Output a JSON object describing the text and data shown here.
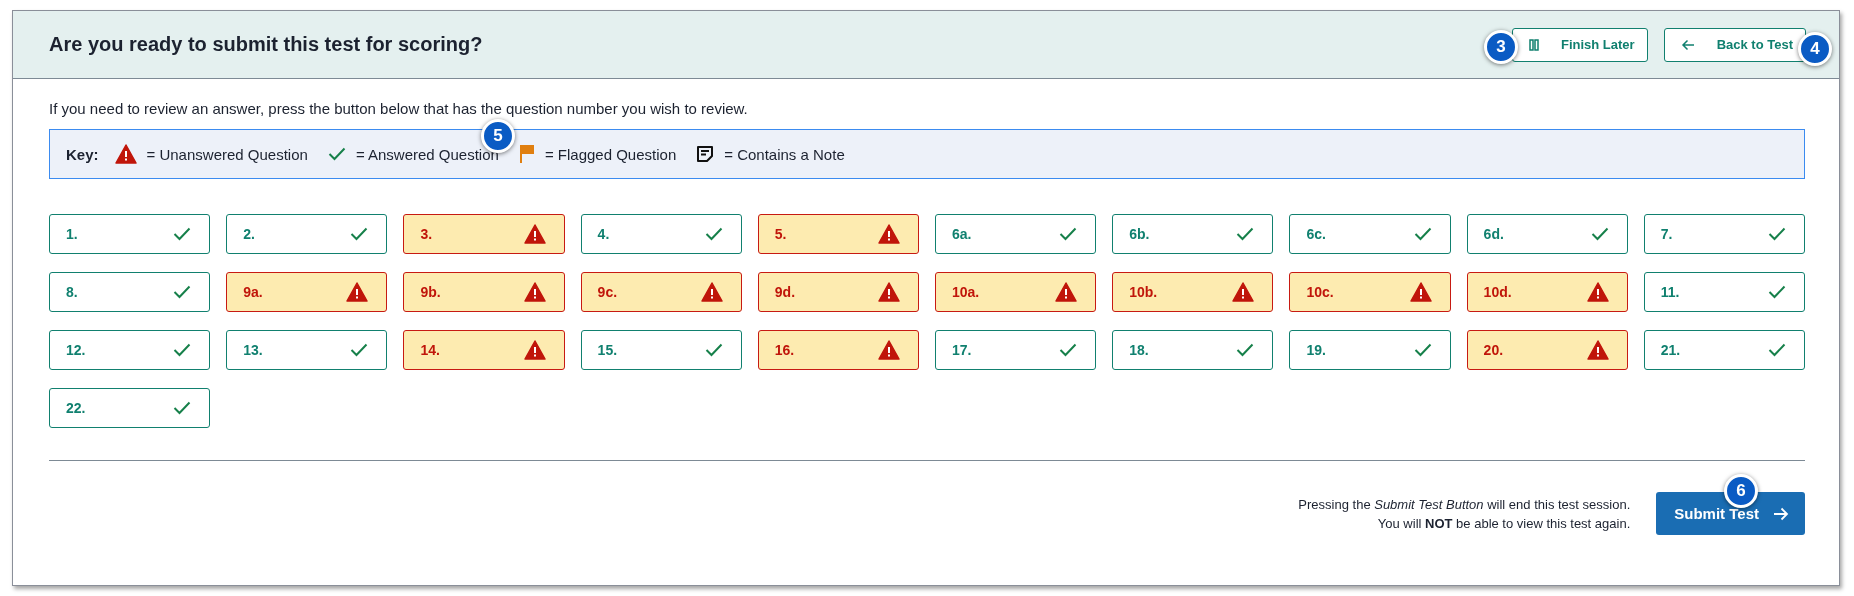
{
  "header": {
    "title": "Are you ready to submit this test for scoring?",
    "buttons": [
      {
        "kind": "pause",
        "label": "Finish Later"
      },
      {
        "kind": "back",
        "label": "Back to Test"
      }
    ]
  },
  "instruction": "If you need to review an answer, press the button below that has the question number you wish to review.",
  "key": {
    "label": "Key:",
    "items": [
      {
        "kind": "unanswered",
        "label": "= Unanswered Question"
      },
      {
        "kind": "answered",
        "label": "= Answered Question"
      },
      {
        "kind": "flagged",
        "label": "= Flagged Question"
      },
      {
        "kind": "note",
        "label": "= Contains a Note"
      }
    ]
  },
  "questions": [
    {
      "label": "1.",
      "answered": true
    },
    {
      "label": "2.",
      "answered": true
    },
    {
      "label": "3.",
      "answered": false
    },
    {
      "label": "4.",
      "answered": true
    },
    {
      "label": "5.",
      "answered": false
    },
    {
      "label": "6a.",
      "answered": true
    },
    {
      "label": "6b.",
      "answered": true
    },
    {
      "label": "6c.",
      "answered": true
    },
    {
      "label": "6d.",
      "answered": true
    },
    {
      "label": "7.",
      "answered": true
    },
    {
      "label": "8.",
      "answered": true
    },
    {
      "label": "9a.",
      "answered": false
    },
    {
      "label": "9b.",
      "answered": false
    },
    {
      "label": "9c.",
      "answered": false
    },
    {
      "label": "9d.",
      "answered": false
    },
    {
      "label": "10a.",
      "answered": false
    },
    {
      "label": "10b.",
      "answered": false
    },
    {
      "label": "10c.",
      "answered": false
    },
    {
      "label": "10d.",
      "answered": false
    },
    {
      "label": "11.",
      "answered": true
    },
    {
      "label": "12.",
      "answered": true
    },
    {
      "label": "13.",
      "answered": true
    },
    {
      "label": "14.",
      "answered": false
    },
    {
      "label": "15.",
      "answered": true
    },
    {
      "label": "16.",
      "answered": false
    },
    {
      "label": "17.",
      "answered": true
    },
    {
      "label": "18.",
      "answered": true
    },
    {
      "label": "19.",
      "answered": true
    },
    {
      "label": "20.",
      "answered": false
    },
    {
      "label": "21.",
      "answered": true
    },
    {
      "label": "22.",
      "answered": true
    }
  ],
  "footer": {
    "notice": [
      "Pressing the *Submit Test Button* will end this test session.",
      "You will **NOT** be able to view this test again."
    ],
    "submit_button": "Submit Test"
  },
  "callouts": [
    {
      "label": "3"
    },
    {
      "label": "4"
    },
    {
      "label": "5"
    },
    {
      "label": "6"
    }
  ]
}
